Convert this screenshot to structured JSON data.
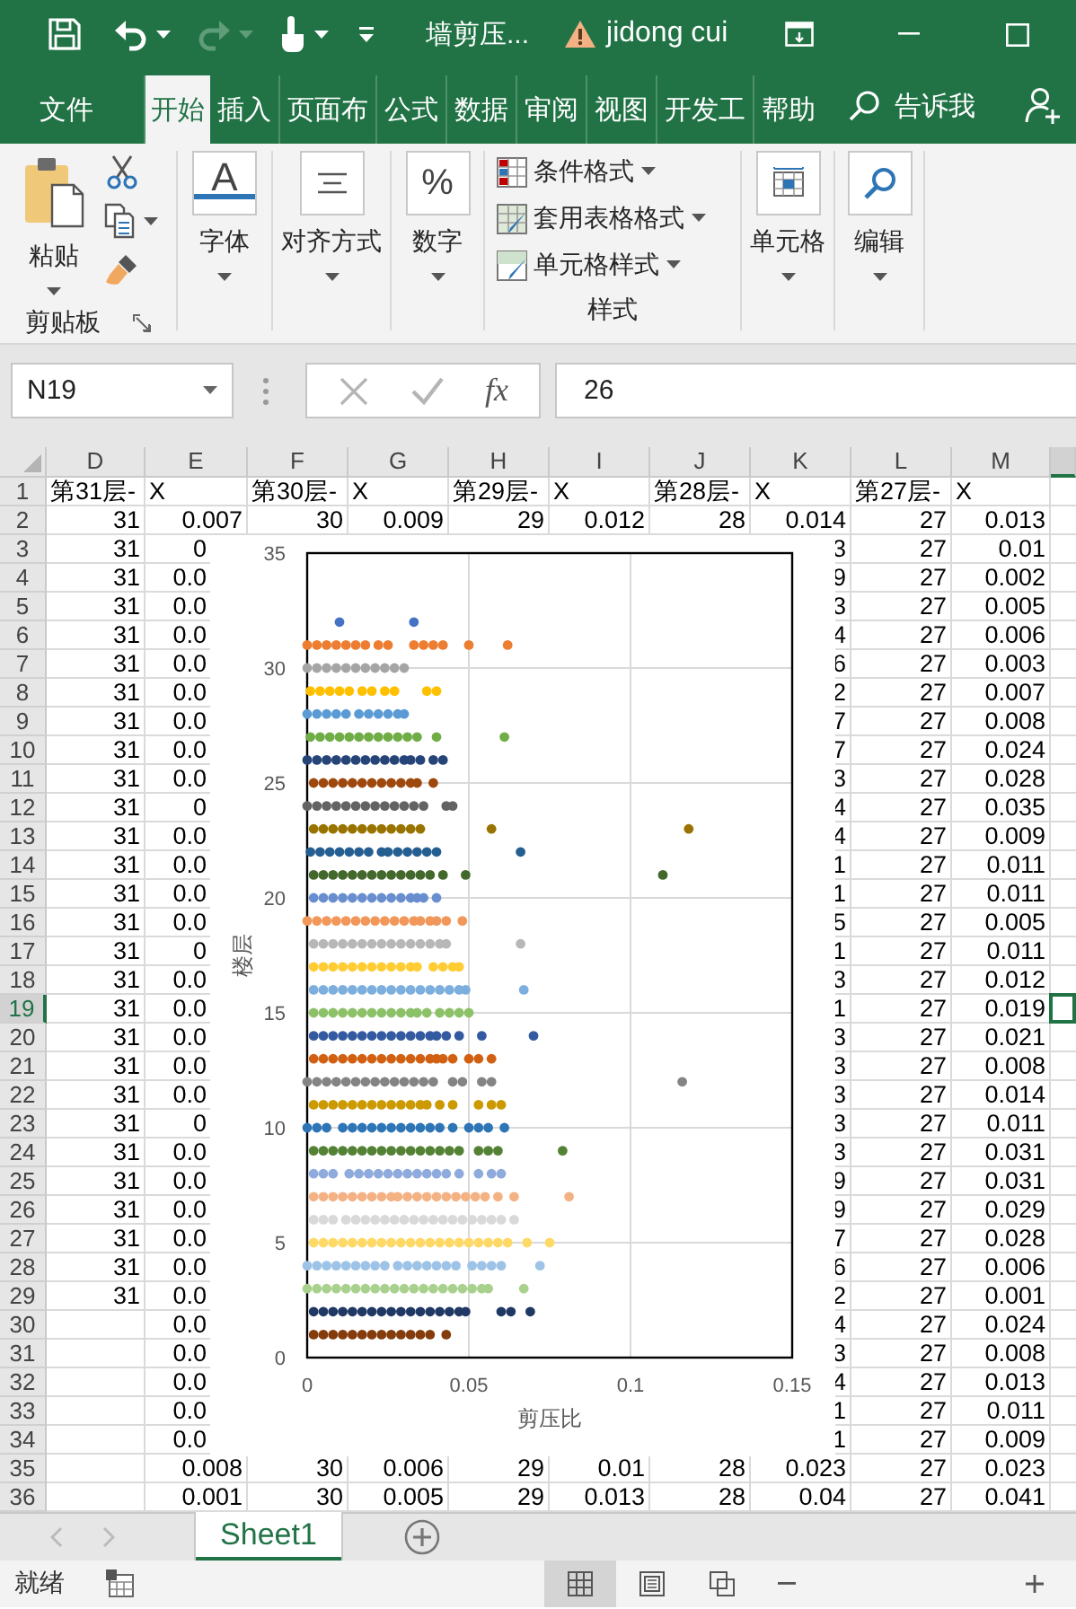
{
  "title_bar": {
    "file_name": "墙剪压...",
    "user_name": "jidong cui"
  },
  "ribbon_tabs": [
    {
      "label": "文件",
      "selected": false
    },
    {
      "label": "开始",
      "selected": true
    },
    {
      "label": "插入",
      "selected": false
    },
    {
      "label": "页面布",
      "selected": false
    },
    {
      "label": "公式",
      "selected": false
    },
    {
      "label": "数据",
      "selected": false
    },
    {
      "label": "审阅",
      "selected": false
    },
    {
      "label": "视图",
      "selected": false
    },
    {
      "label": "开发工",
      "selected": false
    },
    {
      "label": "帮助",
      "selected": false
    }
  ],
  "tell_me": "告诉我",
  "ribbon": {
    "clipboard": {
      "paste": "粘贴",
      "label": "剪贴板"
    },
    "font": {
      "glyph": "A",
      "label": "字体"
    },
    "alignment": {
      "label": "对齐方式"
    },
    "number": {
      "glyph": "%",
      "label": "数字"
    },
    "styles": {
      "items": [
        "条件格式",
        "套用表格格式",
        "单元格样式"
      ],
      "label": "样式"
    },
    "cells": {
      "label": "单元格"
    },
    "editing": {
      "label": "编辑"
    }
  },
  "formula_bar": {
    "name_box": "N19",
    "function_button": "fx",
    "value": "26"
  },
  "sheet": {
    "columns": [
      {
        "label": "D",
        "selected": false
      },
      {
        "label": "E",
        "selected": false
      },
      {
        "label": "F",
        "selected": false
      },
      {
        "label": "G",
        "selected": false
      },
      {
        "label": "H",
        "selected": false
      },
      {
        "label": "I",
        "selected": false
      },
      {
        "label": "J",
        "selected": false
      },
      {
        "label": "K",
        "selected": false
      },
      {
        "label": "L",
        "selected": false
      },
      {
        "label": "M",
        "selected": false
      },
      {
        "selected": true
      }
    ],
    "rows": [
      {
        "header": "1",
        "selected": false,
        "cells": [
          "第31层-",
          "X",
          "第30层-",
          "X",
          "第29层-",
          "X",
          "第28层-",
          "X",
          "第27层-",
          "X",
          null
        ]
      },
      {
        "header": "2",
        "selected": false,
        "cells": [
          "31",
          "0.007",
          "30",
          "0.009",
          "29",
          "0.012",
          "28",
          "0.014",
          "27",
          "0.013",
          null
        ]
      },
      {
        "header": "3",
        "selected": false,
        "cells": [
          "31",
          "0",
          null,
          null,
          null,
          null,
          null,
          "3",
          "27",
          "0.01",
          null
        ]
      },
      {
        "header": "4",
        "selected": false,
        "cells": [
          "31",
          "0.0",
          null,
          null,
          null,
          null,
          null,
          "9",
          "27",
          "0.002",
          null
        ]
      },
      {
        "header": "5",
        "selected": false,
        "cells": [
          "31",
          "0.0",
          null,
          null,
          null,
          null,
          null,
          "3",
          "27",
          "0.005",
          null
        ]
      },
      {
        "header": "6",
        "selected": false,
        "cells": [
          "31",
          "0.0",
          null,
          null,
          null,
          null,
          null,
          "4",
          "27",
          "0.006",
          null
        ]
      },
      {
        "header": "7",
        "selected": false,
        "cells": [
          "31",
          "0.0",
          null,
          null,
          null,
          null,
          null,
          "6",
          "27",
          "0.003",
          null
        ]
      },
      {
        "header": "8",
        "selected": false,
        "cells": [
          "31",
          "0.0",
          null,
          null,
          null,
          null,
          null,
          "2",
          "27",
          "0.007",
          null
        ]
      },
      {
        "header": "9",
        "selected": false,
        "cells": [
          "31",
          "0.0",
          null,
          null,
          null,
          null,
          null,
          "7",
          "27",
          "0.008",
          null
        ]
      },
      {
        "header": "10",
        "selected": false,
        "cells": [
          "31",
          "0.0",
          null,
          null,
          null,
          null,
          null,
          "7",
          "27",
          "0.024",
          null
        ]
      },
      {
        "header": "11",
        "selected": false,
        "cells": [
          "31",
          "0.0",
          null,
          null,
          null,
          null,
          null,
          "3",
          "27",
          "0.028",
          null
        ]
      },
      {
        "header": "12",
        "selected": false,
        "cells": [
          "31",
          "0",
          null,
          null,
          null,
          null,
          null,
          "4",
          "27",
          "0.035",
          null
        ]
      },
      {
        "header": "13",
        "selected": false,
        "cells": [
          "31",
          "0.0",
          null,
          null,
          null,
          null,
          null,
          "4",
          "27",
          "0.009",
          null
        ]
      },
      {
        "header": "14",
        "selected": false,
        "cells": [
          "31",
          "0.0",
          null,
          null,
          null,
          null,
          null,
          "1",
          "27",
          "0.011",
          null
        ]
      },
      {
        "header": "15",
        "selected": false,
        "cells": [
          "31",
          "0.0",
          null,
          null,
          null,
          null,
          null,
          "1",
          "27",
          "0.011",
          null
        ]
      },
      {
        "header": "16",
        "selected": false,
        "cells": [
          "31",
          "0.0",
          null,
          null,
          null,
          null,
          null,
          "5",
          "27",
          "0.005",
          null
        ]
      },
      {
        "header": "17",
        "selected": false,
        "cells": [
          "31",
          "0",
          null,
          null,
          null,
          null,
          null,
          "1",
          "27",
          "0.011",
          null
        ]
      },
      {
        "header": "18",
        "selected": false,
        "cells": [
          "31",
          "0.0",
          null,
          null,
          null,
          null,
          null,
          "3",
          "27",
          "0.012",
          null
        ]
      },
      {
        "header": "19",
        "selected": true,
        "cells": [
          "31",
          "0.0",
          null,
          null,
          null,
          null,
          null,
          "1",
          "27",
          "0.019",
          null
        ]
      },
      {
        "header": "20",
        "selected": false,
        "cells": [
          "31",
          "0.0",
          null,
          null,
          null,
          null,
          null,
          "3",
          "27",
          "0.021",
          null
        ]
      },
      {
        "header": "21",
        "selected": false,
        "cells": [
          "31",
          "0.0",
          null,
          null,
          null,
          null,
          null,
          "3",
          "27",
          "0.008",
          null
        ]
      },
      {
        "header": "22",
        "selected": false,
        "cells": [
          "31",
          "0.0",
          null,
          null,
          null,
          null,
          null,
          "3",
          "27",
          "0.014",
          null
        ]
      },
      {
        "header": "23",
        "selected": false,
        "cells": [
          "31",
          "0",
          null,
          null,
          null,
          null,
          null,
          "3",
          "27",
          "0.011",
          null
        ]
      },
      {
        "header": "24",
        "selected": false,
        "cells": [
          "31",
          "0.0",
          null,
          null,
          null,
          null,
          null,
          "3",
          "27",
          "0.031",
          null
        ]
      },
      {
        "header": "25",
        "selected": false,
        "cells": [
          "31",
          "0.0",
          null,
          null,
          null,
          null,
          null,
          "9",
          "27",
          "0.031",
          null
        ]
      },
      {
        "header": "26",
        "selected": false,
        "cells": [
          "31",
          "0.0",
          null,
          null,
          null,
          null,
          null,
          "9",
          "27",
          "0.029",
          null
        ]
      },
      {
        "header": "27",
        "selected": false,
        "cells": [
          "31",
          "0.0",
          null,
          null,
          null,
          null,
          null,
          "7",
          "27",
          "0.028",
          null
        ]
      },
      {
        "header": "28",
        "selected": false,
        "cells": [
          "31",
          "0.0",
          null,
          null,
          null,
          null,
          null,
          "6",
          "27",
          "0.006",
          null
        ]
      },
      {
        "header": "29",
        "selected": false,
        "cells": [
          "31",
          "0.0",
          null,
          null,
          null,
          null,
          null,
          "2",
          "27",
          "0.001",
          null
        ]
      },
      {
        "header": "30",
        "selected": false,
        "cells": [
          null,
          "0.0",
          null,
          null,
          null,
          null,
          null,
          "4",
          "27",
          "0.024",
          null
        ]
      },
      {
        "header": "31",
        "selected": false,
        "cells": [
          null,
          "0.0",
          null,
          null,
          null,
          null,
          null,
          "3",
          "27",
          "0.008",
          null
        ]
      },
      {
        "header": "32",
        "selected": false,
        "cells": [
          null,
          "0.0",
          null,
          null,
          null,
          null,
          null,
          "4",
          "27",
          "0.013",
          null
        ]
      },
      {
        "header": "33",
        "selected": false,
        "cells": [
          null,
          "0.0",
          null,
          null,
          null,
          null,
          null,
          "1",
          "27",
          "0.011",
          null
        ]
      },
      {
        "header": "34",
        "selected": false,
        "cells": [
          null,
          "0.0",
          null,
          null,
          null,
          null,
          null,
          "1",
          "27",
          "0.009",
          null
        ]
      },
      {
        "header": "35",
        "selected": false,
        "cells": [
          null,
          "0.008",
          "30",
          "0.006",
          "29",
          "0.01",
          "28",
          "0.023",
          "27",
          "0.023",
          null
        ]
      },
      {
        "header": "36",
        "selected": false,
        "cells": [
          null,
          "0.001",
          "30",
          "0.005",
          "29",
          "0.013",
          "28",
          "0.04",
          "27",
          "0.041",
          null
        ]
      }
    ],
    "chart": {
      "chart_data": {
        "type": "scatter",
        "grid": true,
        "xlabel": "剪压比",
        "ylabel": "楼层",
        "xlim": [
          0,
          0.15
        ],
        "ylim": [
          0,
          35
        ],
        "xticks": [
          0,
          0.05,
          0.1,
          0.15
        ],
        "yticks": [
          0,
          5,
          10,
          15,
          20,
          25,
          30,
          35
        ],
        "series": [
          {
            "color": "#4472c4",
            "x": [
              0.01,
              0.033
            ],
            "values": [
              32,
              32
            ]
          },
          {
            "color": "#ed7d31",
            "x": [
              0,
              0.003,
              0.006,
              0.009,
              0.012,
              0.015,
              0.018,
              0.022,
              0.025,
              0.033,
              0.036,
              0.039,
              0.042,
              0.05,
              0.062
            ],
            "values": [
              31,
              31,
              31,
              31,
              31,
              31,
              31,
              31,
              31,
              31,
              31,
              31,
              31,
              31,
              31
            ]
          },
          {
            "color": "#a5a5a5",
            "x": [
              0,
              0.003,
              0.006,
              0.009,
              0.012,
              0.015,
              0.018,
              0.021,
              0.024,
              0.027,
              0.03
            ],
            "values": [
              30,
              30,
              30,
              30,
              30,
              30,
              30,
              30,
              30,
              30,
              30
            ]
          },
          {
            "color": "#ffc000",
            "x": [
              0.001,
              0.004,
              0.007,
              0.01,
              0.013,
              0.017,
              0.02,
              0.024,
              0.027,
              0.037,
              0.04
            ],
            "values": [
              29,
              29,
              29,
              29,
              29,
              29,
              29,
              29,
              29,
              29,
              29
            ]
          },
          {
            "color": "#5b9bd5",
            "x": [
              0,
              0.003,
              0.006,
              0.009,
              0.012,
              0.016,
              0.019,
              0.022,
              0.025,
              0.028,
              0.03
            ],
            "values": [
              28,
              28,
              28,
              28,
              28,
              28,
              28,
              28,
              28,
              28,
              28
            ]
          },
          {
            "color": "#70ad47",
            "x": [
              0.001,
              0.004,
              0.007,
              0.01,
              0.013,
              0.016,
              0.019,
              0.022,
              0.025,
              0.028,
              0.031,
              0.034,
              0.04,
              0.061
            ],
            "values": [
              27,
              27,
              27,
              27,
              27,
              27,
              27,
              27,
              27,
              27,
              27,
              27,
              27,
              27
            ]
          },
          {
            "color": "#264478",
            "x": [
              0,
              0.003,
              0.006,
              0.009,
              0.012,
              0.015,
              0.018,
              0.021,
              0.024,
              0.027,
              0.03,
              0.032,
              0.035,
              0.039,
              0.042
            ],
            "values": [
              26,
              26,
              26,
              26,
              26,
              26,
              26,
              26,
              26,
              26,
              26,
              26,
              26,
              26,
              26
            ]
          },
          {
            "color": "#9e480e",
            "x": [
              0.002,
              0.005,
              0.008,
              0.011,
              0.014,
              0.017,
              0.02,
              0.023,
              0.026,
              0.029,
              0.032,
              0.034,
              0.039
            ],
            "values": [
              25,
              25,
              25,
              25,
              25,
              25,
              25,
              25,
              25,
              25,
              25,
              25,
              25
            ]
          },
          {
            "color": "#636363",
            "x": [
              0,
              0.003,
              0.006,
              0.009,
              0.012,
              0.015,
              0.018,
              0.021,
              0.024,
              0.027,
              0.03,
              0.033,
              0.036,
              0.043,
              0.045
            ],
            "values": [
              24,
              24,
              24,
              24,
              24,
              24,
              24,
              24,
              24,
              24,
              24,
              24,
              24,
              24,
              24
            ]
          },
          {
            "color": "#997300",
            "x": [
              0.002,
              0.005,
              0.008,
              0.011,
              0.014,
              0.017,
              0.02,
              0.023,
              0.026,
              0.029,
              0.032,
              0.035,
              0.057,
              0.118
            ],
            "values": [
              23,
              23,
              23,
              23,
              23,
              23,
              23,
              23,
              23,
              23,
              23,
              23,
              23,
              23
            ]
          },
          {
            "color": "#255e91",
            "x": [
              0.001,
              0.004,
              0.007,
              0.01,
              0.013,
              0.016,
              0.019,
              0.023,
              0.025,
              0.028,
              0.031,
              0.034,
              0.037,
              0.04,
              0.066
            ],
            "values": [
              22,
              22,
              22,
              22,
              22,
              22,
              22,
              22,
              22,
              22,
              22,
              22,
              22,
              22,
              22
            ]
          },
          {
            "color": "#43682b",
            "x": [
              0.002,
              0.005,
              0.008,
              0.011,
              0.014,
              0.017,
              0.02,
              0.023,
              0.026,
              0.029,
              0.032,
              0.035,
              0.038,
              0.042,
              0.049,
              0.11
            ],
            "values": [
              21,
              21,
              21,
              21,
              21,
              21,
              21,
              21,
              21,
              21,
              21,
              21,
              21,
              21,
              21,
              21
            ]
          },
          {
            "color": "#698ed0",
            "x": [
              0.002,
              0.005,
              0.008,
              0.011,
              0.014,
              0.017,
              0.02,
              0.023,
              0.026,
              0.029,
              0.032,
              0.034,
              0.036,
              0.04
            ],
            "values": [
              20,
              20,
              20,
              20,
              20,
              20,
              20,
              20,
              20,
              20,
              20,
              20,
              20,
              20
            ]
          },
          {
            "color": "#f1975a",
            "x": [
              0,
              0.003,
              0.006,
              0.009,
              0.012,
              0.015,
              0.018,
              0.021,
              0.024,
              0.027,
              0.03,
              0.033,
              0.035,
              0.038,
              0.04,
              0.043,
              0.048
            ],
            "values": [
              19,
              19,
              19,
              19,
              19,
              19,
              19,
              19,
              19,
              19,
              19,
              19,
              19,
              19,
              19,
              19,
              19
            ]
          },
          {
            "color": "#b7b7b7",
            "x": [
              0.002,
              0.005,
              0.008,
              0.011,
              0.014,
              0.017,
              0.02,
              0.023,
              0.026,
              0.029,
              0.032,
              0.035,
              0.038,
              0.041,
              0.043,
              0.066
            ],
            "values": [
              18,
              18,
              18,
              18,
              18,
              18,
              18,
              18,
              18,
              18,
              18,
              18,
              18,
              18,
              18,
              18
            ]
          },
          {
            "color": "#ffcd33",
            "x": [
              0.002,
              0.005,
              0.008,
              0.011,
              0.014,
              0.017,
              0.02,
              0.023,
              0.026,
              0.029,
              0.032,
              0.034,
              0.039,
              0.042,
              0.045,
              0.047
            ],
            "values": [
              17,
              17,
              17,
              17,
              17,
              17,
              17,
              17,
              17,
              17,
              17,
              17,
              17,
              17,
              17,
              17
            ]
          },
          {
            "color": "#7cafdd",
            "x": [
              0.002,
              0.005,
              0.008,
              0.011,
              0.014,
              0.017,
              0.02,
              0.023,
              0.026,
              0.029,
              0.032,
              0.035,
              0.038,
              0.041,
              0.044,
              0.047,
              0.049,
              0.067
            ],
            "values": [
              16,
              16,
              16,
              16,
              16,
              16,
              16,
              16,
              16,
              16,
              16,
              16,
              16,
              16,
              16,
              16,
              16,
              16
            ]
          },
          {
            "color": "#8cc168",
            "x": [
              0.002,
              0.005,
              0.008,
              0.011,
              0.014,
              0.017,
              0.02,
              0.023,
              0.026,
              0.029,
              0.032,
              0.034,
              0.037,
              0.041,
              0.044,
              0.047,
              0.05
            ],
            "values": [
              15,
              15,
              15,
              15,
              15,
              15,
              15,
              15,
              15,
              15,
              15,
              15,
              15,
              15,
              15,
              15,
              15
            ]
          },
          {
            "color": "#335aa1",
            "x": [
              0.002,
              0.005,
              0.008,
              0.011,
              0.014,
              0.017,
              0.02,
              0.023,
              0.026,
              0.029,
              0.032,
              0.035,
              0.038,
              0.04,
              0.043,
              0.047,
              0.054,
              0.07
            ],
            "values": [
              14,
              14,
              14,
              14,
              14,
              14,
              14,
              14,
              14,
              14,
              14,
              14,
              14,
              14,
              14,
              14,
              14,
              14
            ]
          },
          {
            "color": "#d26012",
            "x": [
              0.002,
              0.005,
              0.008,
              0.011,
              0.014,
              0.017,
              0.02,
              0.023,
              0.026,
              0.029,
              0.032,
              0.035,
              0.038,
              0.04,
              0.042,
              0.045,
              0.05,
              0.053,
              0.057
            ],
            "values": [
              13,
              13,
              13,
              13,
              13,
              13,
              13,
              13,
              13,
              13,
              13,
              13,
              13,
              13,
              13,
              13,
              13,
              13,
              13
            ]
          },
          {
            "color": "#848484",
            "x": [
              0,
              0.003,
              0.006,
              0.009,
              0.012,
              0.015,
              0.018,
              0.021,
              0.024,
              0.027,
              0.03,
              0.033,
              0.036,
              0.039,
              0.045,
              0.048,
              0.054,
              0.057,
              0.116
            ],
            "values": [
              12,
              12,
              12,
              12,
              12,
              12,
              12,
              12,
              12,
              12,
              12,
              12,
              12,
              12,
              12,
              12,
              12,
              12,
              12
            ]
          },
          {
            "color": "#cc9a00",
            "x": [
              0.002,
              0.005,
              0.008,
              0.011,
              0.014,
              0.017,
              0.02,
              0.023,
              0.026,
              0.029,
              0.032,
              0.035,
              0.037,
              0.041,
              0.045,
              0.053,
              0.057,
              0.06
            ],
            "values": [
              11,
              11,
              11,
              11,
              11,
              11,
              11,
              11,
              11,
              11,
              11,
              11,
              11,
              11,
              11,
              11,
              11,
              11
            ]
          },
          {
            "color": "#2e75b6",
            "x": [
              0,
              0.003,
              0.006,
              0.011,
              0.014,
              0.017,
              0.02,
              0.023,
              0.026,
              0.029,
              0.032,
              0.035,
              0.038,
              0.041,
              0.045,
              0.05,
              0.053,
              0.056,
              0.061
            ],
            "values": [
              10,
              10,
              10,
              10,
              10,
              10,
              10,
              10,
              10,
              10,
              10,
              10,
              10,
              10,
              10,
              10,
              10,
              10,
              10
            ]
          },
          {
            "color": "#548235",
            "x": [
              0.002,
              0.005,
              0.008,
              0.011,
              0.014,
              0.017,
              0.02,
              0.023,
              0.026,
              0.029,
              0.032,
              0.035,
              0.038,
              0.041,
              0.044,
              0.047,
              0.053,
              0.056,
              0.059,
              0.079
            ],
            "values": [
              9,
              9,
              9,
              9,
              9,
              9,
              9,
              9,
              9,
              9,
              9,
              9,
              9,
              9,
              9,
              9,
              9,
              9,
              9,
              9
            ]
          },
          {
            "color": "#8faadc",
            "x": [
              0.002,
              0.005,
              0.008,
              0.013,
              0.016,
              0.019,
              0.022,
              0.025,
              0.028,
              0.031,
              0.034,
              0.037,
              0.04,
              0.043,
              0.047,
              0.053,
              0.057,
              0.06
            ],
            "values": [
              8,
              8,
              8,
              8,
              8,
              8,
              8,
              8,
              8,
              8,
              8,
              8,
              8,
              8,
              8,
              8,
              8,
              8
            ]
          },
          {
            "color": "#f4b183",
            "x": [
              0.002,
              0.005,
              0.008,
              0.011,
              0.014,
              0.017,
              0.02,
              0.023,
              0.026,
              0.028,
              0.031,
              0.034,
              0.037,
              0.04,
              0.043,
              0.046,
              0.049,
              0.052,
              0.055,
              0.059,
              0.064,
              0.081
            ],
            "values": [
              7,
              7,
              7,
              7,
              7,
              7,
              7,
              7,
              7,
              7,
              7,
              7,
              7,
              7,
              7,
              7,
              7,
              7,
              7,
              7,
              7,
              7
            ]
          },
          {
            "color": "#d9d9d9",
            "x": [
              0.002,
              0.005,
              0.008,
              0.012,
              0.015,
              0.018,
              0.021,
              0.024,
              0.027,
              0.03,
              0.033,
              0.036,
              0.039,
              0.042,
              0.045,
              0.048,
              0.051,
              0.054,
              0.057,
              0.06,
              0.064
            ],
            "values": [
              6,
              6,
              6,
              6,
              6,
              6,
              6,
              6,
              6,
              6,
              6,
              6,
              6,
              6,
              6,
              6,
              6,
              6,
              6,
              6,
              6
            ]
          },
          {
            "color": "#ffd966",
            "x": [
              0.002,
              0.005,
              0.008,
              0.011,
              0.014,
              0.017,
              0.02,
              0.023,
              0.026,
              0.029,
              0.032,
              0.035,
              0.038,
              0.041,
              0.044,
              0.047,
              0.05,
              0.053,
              0.056,
              0.059,
              0.062,
              0.068,
              0.075
            ],
            "values": [
              5,
              5,
              5,
              5,
              5,
              5,
              5,
              5,
              5,
              5,
              5,
              5,
              5,
              5,
              5,
              5,
              5,
              5,
              5,
              5,
              5,
              5,
              5
            ]
          },
          {
            "color": "#9dc3e6",
            "x": [
              0,
              0.003,
              0.006,
              0.009,
              0.012,
              0.015,
              0.018,
              0.021,
              0.024,
              0.028,
              0.031,
              0.034,
              0.037,
              0.04,
              0.043,
              0.046,
              0.051,
              0.054,
              0.057,
              0.06,
              0.072
            ],
            "values": [
              4,
              4,
              4,
              4,
              4,
              4,
              4,
              4,
              4,
              4,
              4,
              4,
              4,
              4,
              4,
              4,
              4,
              4,
              4,
              4,
              4
            ]
          },
          {
            "color": "#a9d18e",
            "x": [
              0,
              0.003,
              0.006,
              0.009,
              0.012,
              0.015,
              0.018,
              0.021,
              0.024,
              0.027,
              0.03,
              0.033,
              0.036,
              0.039,
              0.042,
              0.045,
              0.048,
              0.051,
              0.054,
              0.056,
              0.067
            ],
            "values": [
              3,
              3,
              3,
              3,
              3,
              3,
              3,
              3,
              3,
              3,
              3,
              3,
              3,
              3,
              3,
              3,
              3,
              3,
              3,
              3,
              3
            ]
          },
          {
            "color": "#203864",
            "x": [
              0.002,
              0.005,
              0.008,
              0.011,
              0.014,
              0.017,
              0.02,
              0.023,
              0.026,
              0.029,
              0.032,
              0.035,
              0.038,
              0.041,
              0.044,
              0.047,
              0.049,
              0.06,
              0.063,
              0.069
            ],
            "values": [
              2,
              2,
              2,
              2,
              2,
              2,
              2,
              2,
              2,
              2,
              2,
              2,
              2,
              2,
              2,
              2,
              2,
              2,
              2,
              2
            ]
          },
          {
            "color": "#843c0c",
            "x": [
              0.002,
              0.005,
              0.008,
              0.011,
              0.014,
              0.017,
              0.02,
              0.023,
              0.026,
              0.029,
              0.032,
              0.035,
              0.038,
              0.043
            ],
            "values": [
              1,
              1,
              1,
              1,
              1,
              1,
              1,
              1,
              1,
              1,
              1,
              1,
              1,
              1
            ]
          }
        ]
      }
    }
  },
  "sheet_tabs": [
    {
      "label": "Sheet1",
      "selected": true
    }
  ],
  "status_bar": {
    "status": "就绪"
  }
}
